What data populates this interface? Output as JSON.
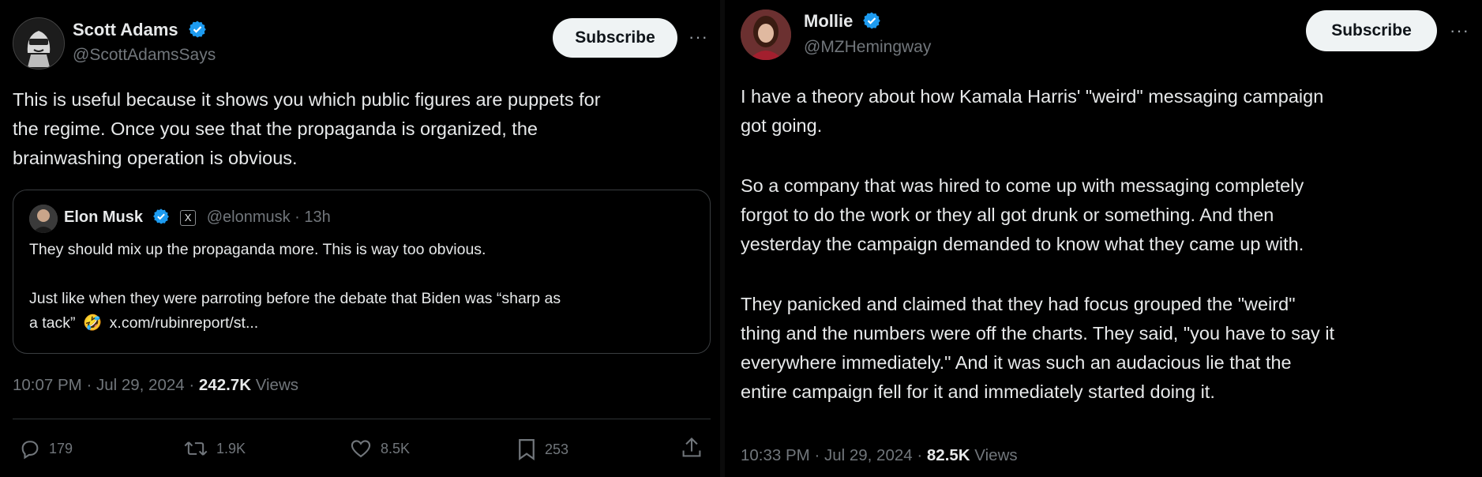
{
  "left_tweet": {
    "author_name": "Scott Adams",
    "author_handle": "@ScottAdamsSays",
    "subscribe_label": "Subscribe",
    "more_label": "···",
    "body": [
      "This is useful because it shows you which public figures are puppets for",
      "the regime. Once you see that the propaganda is organized, the",
      "brainwashing operation is obvious."
    ],
    "quote": {
      "author_name": "Elon Musk",
      "handle_time": "@elonmusk · 13h",
      "x_badge": "X",
      "line1": "They should mix up the propaganda more. This is way too obvious.",
      "line2": "Just like when they were parroting before the debate that Biden was “sharp as",
      "line3_prefix": "a tack”",
      "emoji": "🤣",
      "link": "x.com/rubinreport/st..."
    },
    "timestamp": "10:07 PM · Jul 29, 2024 · ",
    "views_count": "242.7K",
    "views_label": " Views",
    "actions": {
      "replies": "179",
      "reposts": "1.9K",
      "likes": "8.5K",
      "bookmarks": "253"
    }
  },
  "right_tweet": {
    "author_name": "Mollie",
    "author_handle": "@MZHemingway",
    "subscribe_label": "Subscribe",
    "more_label": "···",
    "paragraphs": [
      [
        "I have a theory about how Kamala Harris' \"weird\" messaging campaign",
        "got going."
      ],
      [
        "So a company that was hired to come up with messaging completely",
        "forgot to do the work or they all got drunk or something. And then",
        "yesterday the campaign demanded to know what they came up with."
      ],
      [
        "They panicked and claimed that they had focus grouped the \"weird\"",
        "thing and the numbers were off the charts. They said, \"you have to say it",
        "everywhere immediately.\" And it was such an audacious lie that the",
        "entire campaign fell for it and immediately started doing it."
      ]
    ],
    "timestamp": "10:33 PM · Jul 29, 2024 · ",
    "views_count": "82.5K",
    "views_label": " Views"
  },
  "colors": {
    "verified_blue": "#1d9bf0",
    "muted_text": "#71767b",
    "primary_text": "#e7e9ea",
    "background": "#000000"
  }
}
